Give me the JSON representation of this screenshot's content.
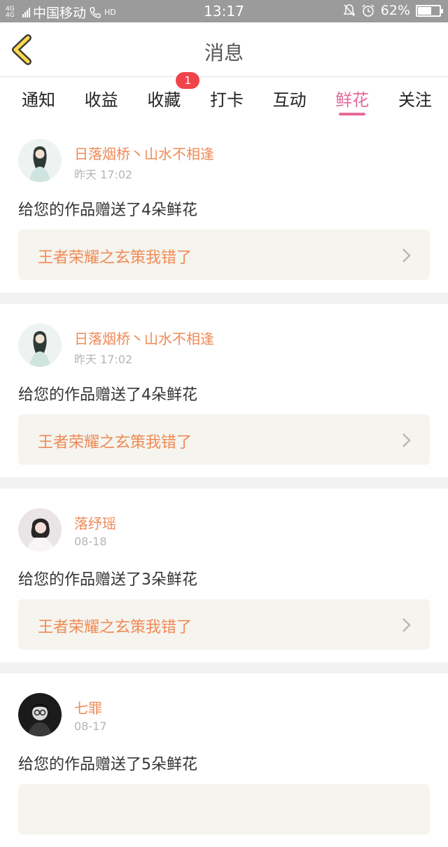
{
  "status_bar": {
    "signal_label": "4G 4G",
    "carrier": "中国移动",
    "hd": "HD",
    "time": "13:17",
    "battery_percent": "62%",
    "battery_level": 0.62
  },
  "header": {
    "title": "消息"
  },
  "tabs": [
    {
      "label": "通知"
    },
    {
      "label": "收益"
    },
    {
      "label": "收藏",
      "badge": "1"
    },
    {
      "label": "打卡"
    },
    {
      "label": "互动"
    },
    {
      "label": "鲜花",
      "active": true
    },
    {
      "label": "关注"
    }
  ],
  "items": [
    {
      "user": "日落烟桥丶山水不相逢",
      "time": "昨天 17:02",
      "message": "给您的作品赠送了4朵鲜花",
      "work": "王者荣耀之玄策我错了",
      "avatar": "ink-painting-girl-avatar"
    },
    {
      "user": "日落烟桥丶山水不相逢",
      "time": "昨天 17:02",
      "message": "给您的作品赠送了4朵鲜花",
      "work": "王者荣耀之玄策我错了",
      "avatar": "ink-painting-girl-avatar"
    },
    {
      "user": "落纾瑶",
      "time": "08-18",
      "message": "给您的作品赠送了3朵鲜花",
      "work": "王者荣耀之玄策我错了",
      "avatar": "girl-photo-avatar"
    },
    {
      "user": "七罪",
      "time": "08-17",
      "message": "给您的作品赠送了5朵鲜花",
      "work": "",
      "avatar": "dark-portrait-avatar"
    }
  ],
  "colors": {
    "accent": "#e46a99",
    "username": "#f08a56",
    "badge": "#f0434a"
  }
}
